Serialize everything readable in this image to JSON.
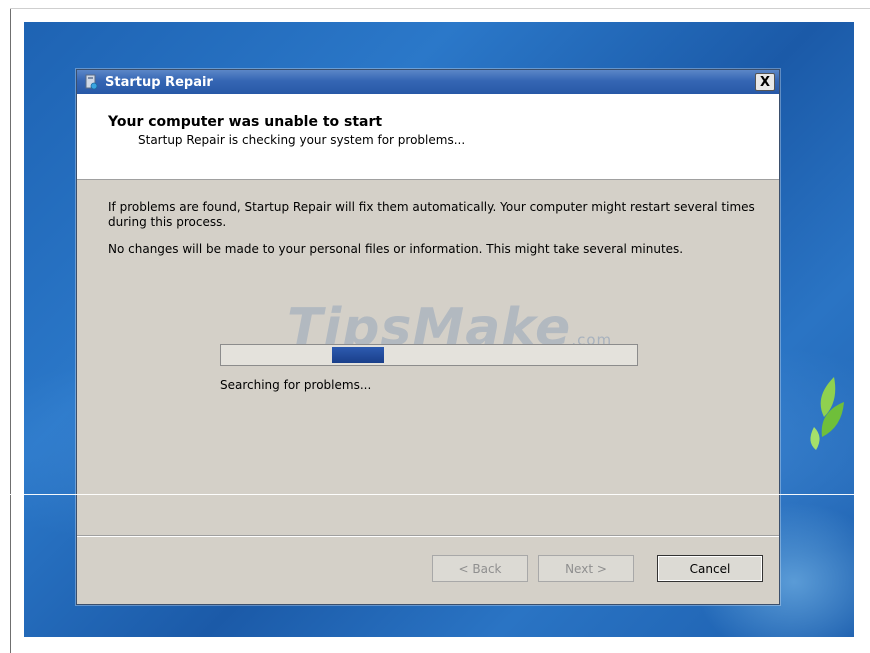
{
  "window": {
    "title": "Startup Repair",
    "close_label": "X"
  },
  "header": {
    "title": "Your computer was unable to start",
    "subtitle": "Startup Repair is checking your system for problems..."
  },
  "body": {
    "paragraph1": "If problems are found, Startup Repair will fix them automatically. Your computer might restart several times during this process.",
    "paragraph2": "No changes will be made to your personal files or information. This might take several minutes."
  },
  "progress": {
    "status_text": "Searching for problems..."
  },
  "buttons": {
    "back": "< Back",
    "next": "Next >",
    "cancel": "Cancel"
  },
  "watermark": {
    "brand": "TipsMake",
    "suffix": ".com"
  },
  "colors": {
    "titlebar": "#3566b4",
    "dialog_bg": "#d4d0c8",
    "progress_fill": "#2d5bb0",
    "desktop": "#1e63b3"
  }
}
